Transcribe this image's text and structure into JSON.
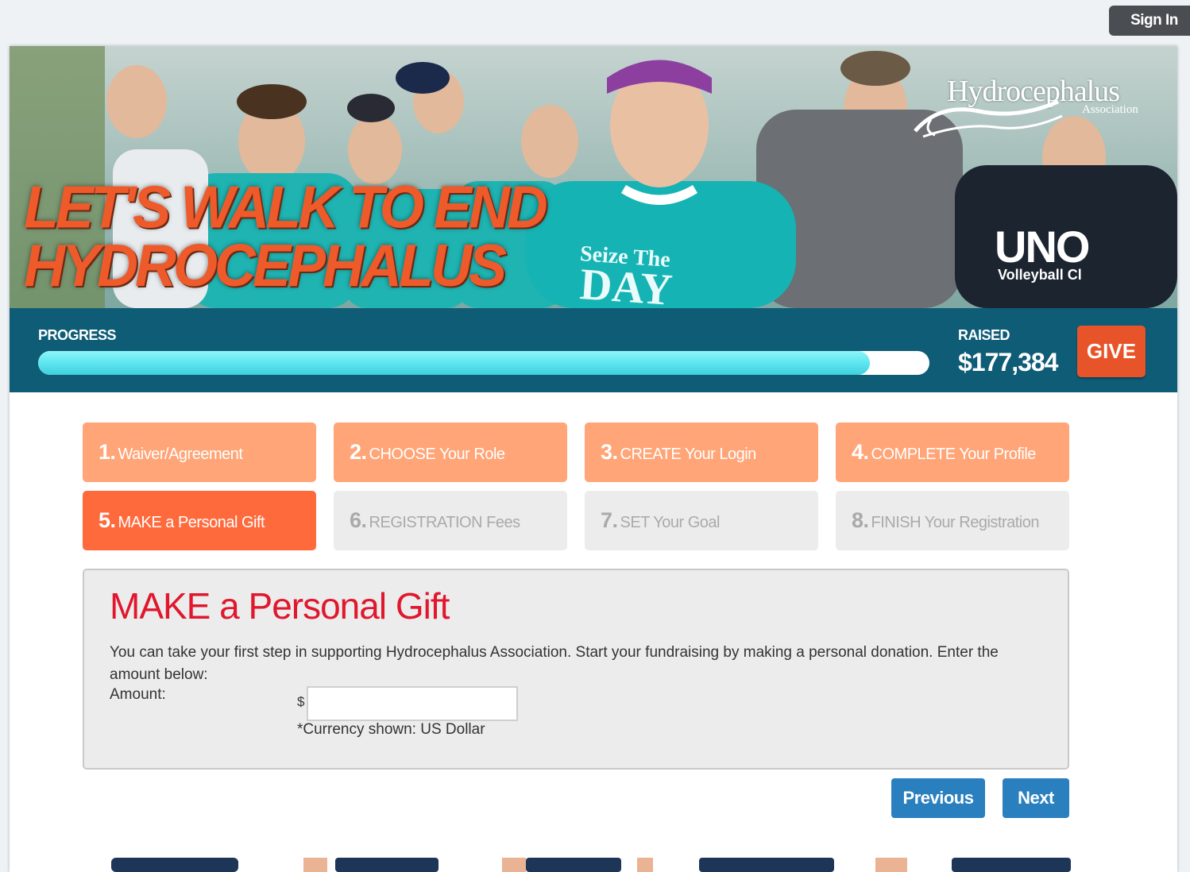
{
  "header": {
    "signin_label": "Sign In"
  },
  "banner": {
    "headline_line1": "LET'S WALK TO END",
    "headline_line2": "HYDROCEPHALUS",
    "logo_name": "Hydrocephalus",
    "logo_sub": "Association",
    "shirt_text_1": "Seize The",
    "shirt_text_2": "DAY",
    "shirt_text_3": "UNO",
    "shirt_text_4": "Volleyball Cl"
  },
  "progress": {
    "label": "PROGRESS",
    "fraction": 0.933,
    "raised_label": "RAISED",
    "raised_value": "$177,384",
    "give_label": "GIVE"
  },
  "steps": [
    {
      "num": "1.",
      "label": "Waiver/Agreement",
      "state": "done"
    },
    {
      "num": "2.",
      "label": "CHOOSE Your Role",
      "state": "done"
    },
    {
      "num": "3.",
      "label": "CREATE Your Login",
      "state": "done"
    },
    {
      "num": "4.",
      "label": "COMPLETE Your Profile",
      "state": "done"
    },
    {
      "num": "5.",
      "label": "MAKE a Personal Gift",
      "state": "active"
    },
    {
      "num": "6.",
      "label": "REGISTRATION Fees",
      "state": "todo"
    },
    {
      "num": "7.",
      "label": "SET Your Goal",
      "state": "todo"
    },
    {
      "num": "8.",
      "label": "FINISH Your Registration",
      "state": "todo"
    }
  ],
  "gift": {
    "title": "MAKE a Personal Gift",
    "description": "You can take your first step in supporting Hydrocephalus Association. Start your fundraising by making a personal donation. Enter the amount below:",
    "amount_label": "Amount:",
    "currency_symbol": "$",
    "amount_value": "",
    "currency_note": "*Currency shown: US Dollar"
  },
  "nav": {
    "previous_label": "Previous",
    "next_label": "Next"
  },
  "colors": {
    "progress_band": "#0f5c77",
    "step_done": "#ffa577",
    "step_active": "#ff6a3c",
    "step_todo": "#ececec",
    "title_red": "#e0172d",
    "nav_button": "#2a7fbf",
    "give": "#e8542a"
  }
}
